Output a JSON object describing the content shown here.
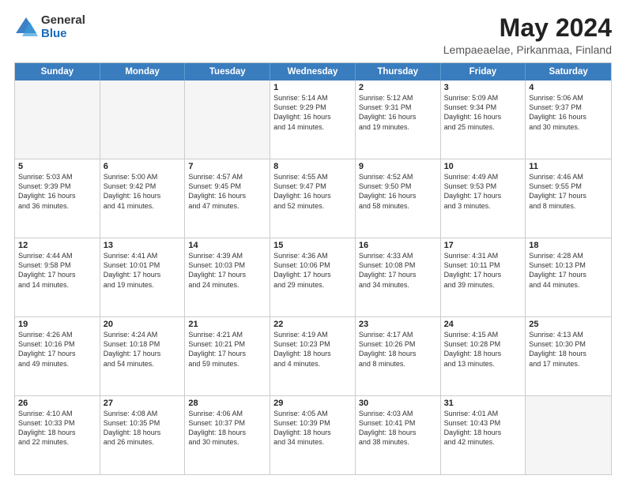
{
  "logo": {
    "general": "General",
    "blue": "Blue"
  },
  "title": "May 2024",
  "subtitle": "Lempaeaelae, Pirkanmaa, Finland",
  "headers": [
    "Sunday",
    "Monday",
    "Tuesday",
    "Wednesday",
    "Thursday",
    "Friday",
    "Saturday"
  ],
  "rows": [
    [
      {
        "day": "",
        "text": "",
        "empty": true
      },
      {
        "day": "",
        "text": "",
        "empty": true
      },
      {
        "day": "",
        "text": "",
        "empty": true
      },
      {
        "day": "1",
        "text": "Sunrise: 5:14 AM\nSunset: 9:29 PM\nDaylight: 16 hours\nand 14 minutes."
      },
      {
        "day": "2",
        "text": "Sunrise: 5:12 AM\nSunset: 9:31 PM\nDaylight: 16 hours\nand 19 minutes."
      },
      {
        "day": "3",
        "text": "Sunrise: 5:09 AM\nSunset: 9:34 PM\nDaylight: 16 hours\nand 25 minutes."
      },
      {
        "day": "4",
        "text": "Sunrise: 5:06 AM\nSunset: 9:37 PM\nDaylight: 16 hours\nand 30 minutes."
      }
    ],
    [
      {
        "day": "5",
        "text": "Sunrise: 5:03 AM\nSunset: 9:39 PM\nDaylight: 16 hours\nand 36 minutes."
      },
      {
        "day": "6",
        "text": "Sunrise: 5:00 AM\nSunset: 9:42 PM\nDaylight: 16 hours\nand 41 minutes."
      },
      {
        "day": "7",
        "text": "Sunrise: 4:57 AM\nSunset: 9:45 PM\nDaylight: 16 hours\nand 47 minutes."
      },
      {
        "day": "8",
        "text": "Sunrise: 4:55 AM\nSunset: 9:47 PM\nDaylight: 16 hours\nand 52 minutes."
      },
      {
        "day": "9",
        "text": "Sunrise: 4:52 AM\nSunset: 9:50 PM\nDaylight: 16 hours\nand 58 minutes."
      },
      {
        "day": "10",
        "text": "Sunrise: 4:49 AM\nSunset: 9:53 PM\nDaylight: 17 hours\nand 3 minutes."
      },
      {
        "day": "11",
        "text": "Sunrise: 4:46 AM\nSunset: 9:55 PM\nDaylight: 17 hours\nand 8 minutes."
      }
    ],
    [
      {
        "day": "12",
        "text": "Sunrise: 4:44 AM\nSunset: 9:58 PM\nDaylight: 17 hours\nand 14 minutes."
      },
      {
        "day": "13",
        "text": "Sunrise: 4:41 AM\nSunset: 10:01 PM\nDaylight: 17 hours\nand 19 minutes."
      },
      {
        "day": "14",
        "text": "Sunrise: 4:39 AM\nSunset: 10:03 PM\nDaylight: 17 hours\nand 24 minutes."
      },
      {
        "day": "15",
        "text": "Sunrise: 4:36 AM\nSunset: 10:06 PM\nDaylight: 17 hours\nand 29 minutes."
      },
      {
        "day": "16",
        "text": "Sunrise: 4:33 AM\nSunset: 10:08 PM\nDaylight: 17 hours\nand 34 minutes."
      },
      {
        "day": "17",
        "text": "Sunrise: 4:31 AM\nSunset: 10:11 PM\nDaylight: 17 hours\nand 39 minutes."
      },
      {
        "day": "18",
        "text": "Sunrise: 4:28 AM\nSunset: 10:13 PM\nDaylight: 17 hours\nand 44 minutes."
      }
    ],
    [
      {
        "day": "19",
        "text": "Sunrise: 4:26 AM\nSunset: 10:16 PM\nDaylight: 17 hours\nand 49 minutes."
      },
      {
        "day": "20",
        "text": "Sunrise: 4:24 AM\nSunset: 10:18 PM\nDaylight: 17 hours\nand 54 minutes."
      },
      {
        "day": "21",
        "text": "Sunrise: 4:21 AM\nSunset: 10:21 PM\nDaylight: 17 hours\nand 59 minutes."
      },
      {
        "day": "22",
        "text": "Sunrise: 4:19 AM\nSunset: 10:23 PM\nDaylight: 18 hours\nand 4 minutes."
      },
      {
        "day": "23",
        "text": "Sunrise: 4:17 AM\nSunset: 10:26 PM\nDaylight: 18 hours\nand 8 minutes."
      },
      {
        "day": "24",
        "text": "Sunrise: 4:15 AM\nSunset: 10:28 PM\nDaylight: 18 hours\nand 13 minutes."
      },
      {
        "day": "25",
        "text": "Sunrise: 4:13 AM\nSunset: 10:30 PM\nDaylight: 18 hours\nand 17 minutes."
      }
    ],
    [
      {
        "day": "26",
        "text": "Sunrise: 4:10 AM\nSunset: 10:33 PM\nDaylight: 18 hours\nand 22 minutes."
      },
      {
        "day": "27",
        "text": "Sunrise: 4:08 AM\nSunset: 10:35 PM\nDaylight: 18 hours\nand 26 minutes."
      },
      {
        "day": "28",
        "text": "Sunrise: 4:06 AM\nSunset: 10:37 PM\nDaylight: 18 hours\nand 30 minutes."
      },
      {
        "day": "29",
        "text": "Sunrise: 4:05 AM\nSunset: 10:39 PM\nDaylight: 18 hours\nand 34 minutes."
      },
      {
        "day": "30",
        "text": "Sunrise: 4:03 AM\nSunset: 10:41 PM\nDaylight: 18 hours\nand 38 minutes."
      },
      {
        "day": "31",
        "text": "Sunrise: 4:01 AM\nSunset: 10:43 PM\nDaylight: 18 hours\nand 42 minutes."
      },
      {
        "day": "",
        "text": "",
        "empty": true
      }
    ]
  ]
}
